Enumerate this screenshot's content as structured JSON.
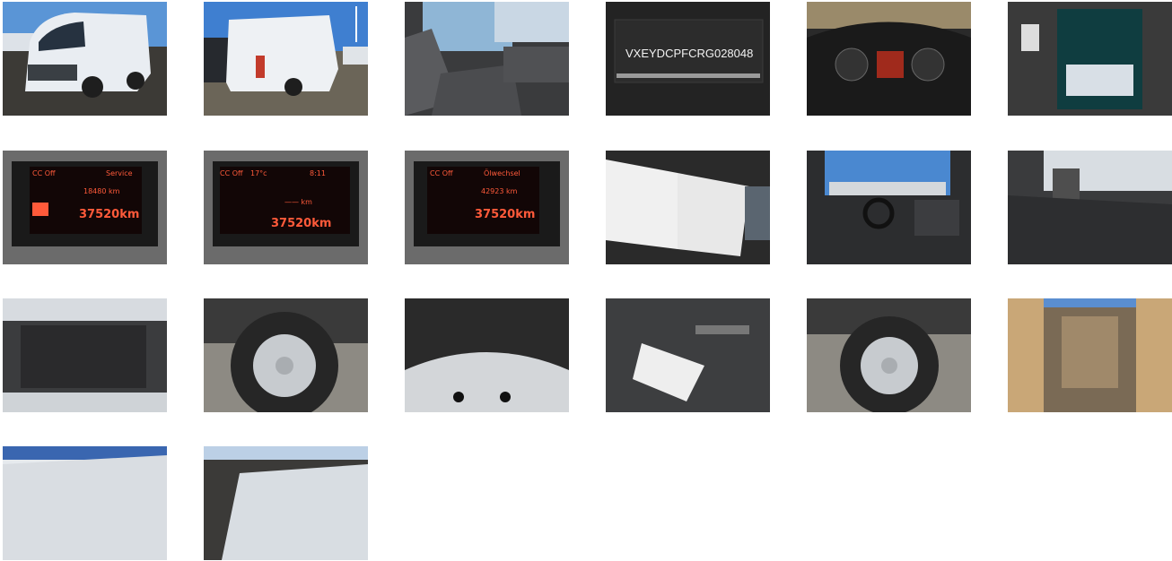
{
  "photos": [
    {
      "label": "front-exterior"
    },
    {
      "label": "rear-exterior"
    },
    {
      "label": "cab-interior-passenger"
    },
    {
      "label": "vin-plate",
      "text": "VXEYDCPFCRG028048"
    },
    {
      "label": "instrument-cluster"
    },
    {
      "label": "documents"
    },
    {
      "label": "display-service",
      "cc": "CC Off",
      "title": "Service",
      "value": "18480 km",
      "odometer": "37520km"
    },
    {
      "label": "display-temp",
      "cc": "CC Off",
      "temp": "17°c",
      "time": "8:11",
      "dash": "—— km",
      "odometer": "37520km"
    },
    {
      "label": "display-oil",
      "cc": "CC Off",
      "title": "Ölwechsel",
      "value": "42923 km",
      "odometer": "37520km"
    },
    {
      "label": "service-booklet"
    },
    {
      "label": "dashboard-interior"
    },
    {
      "label": "rear-seat-area"
    },
    {
      "label": "engine-bay"
    },
    {
      "label": "front-wheel"
    },
    {
      "label": "tire-sidewall"
    },
    {
      "label": "tool-kit"
    },
    {
      "label": "rear-wheel"
    },
    {
      "label": "cargo-area"
    },
    {
      "label": "roof-front"
    },
    {
      "label": "roof-rear"
    }
  ]
}
